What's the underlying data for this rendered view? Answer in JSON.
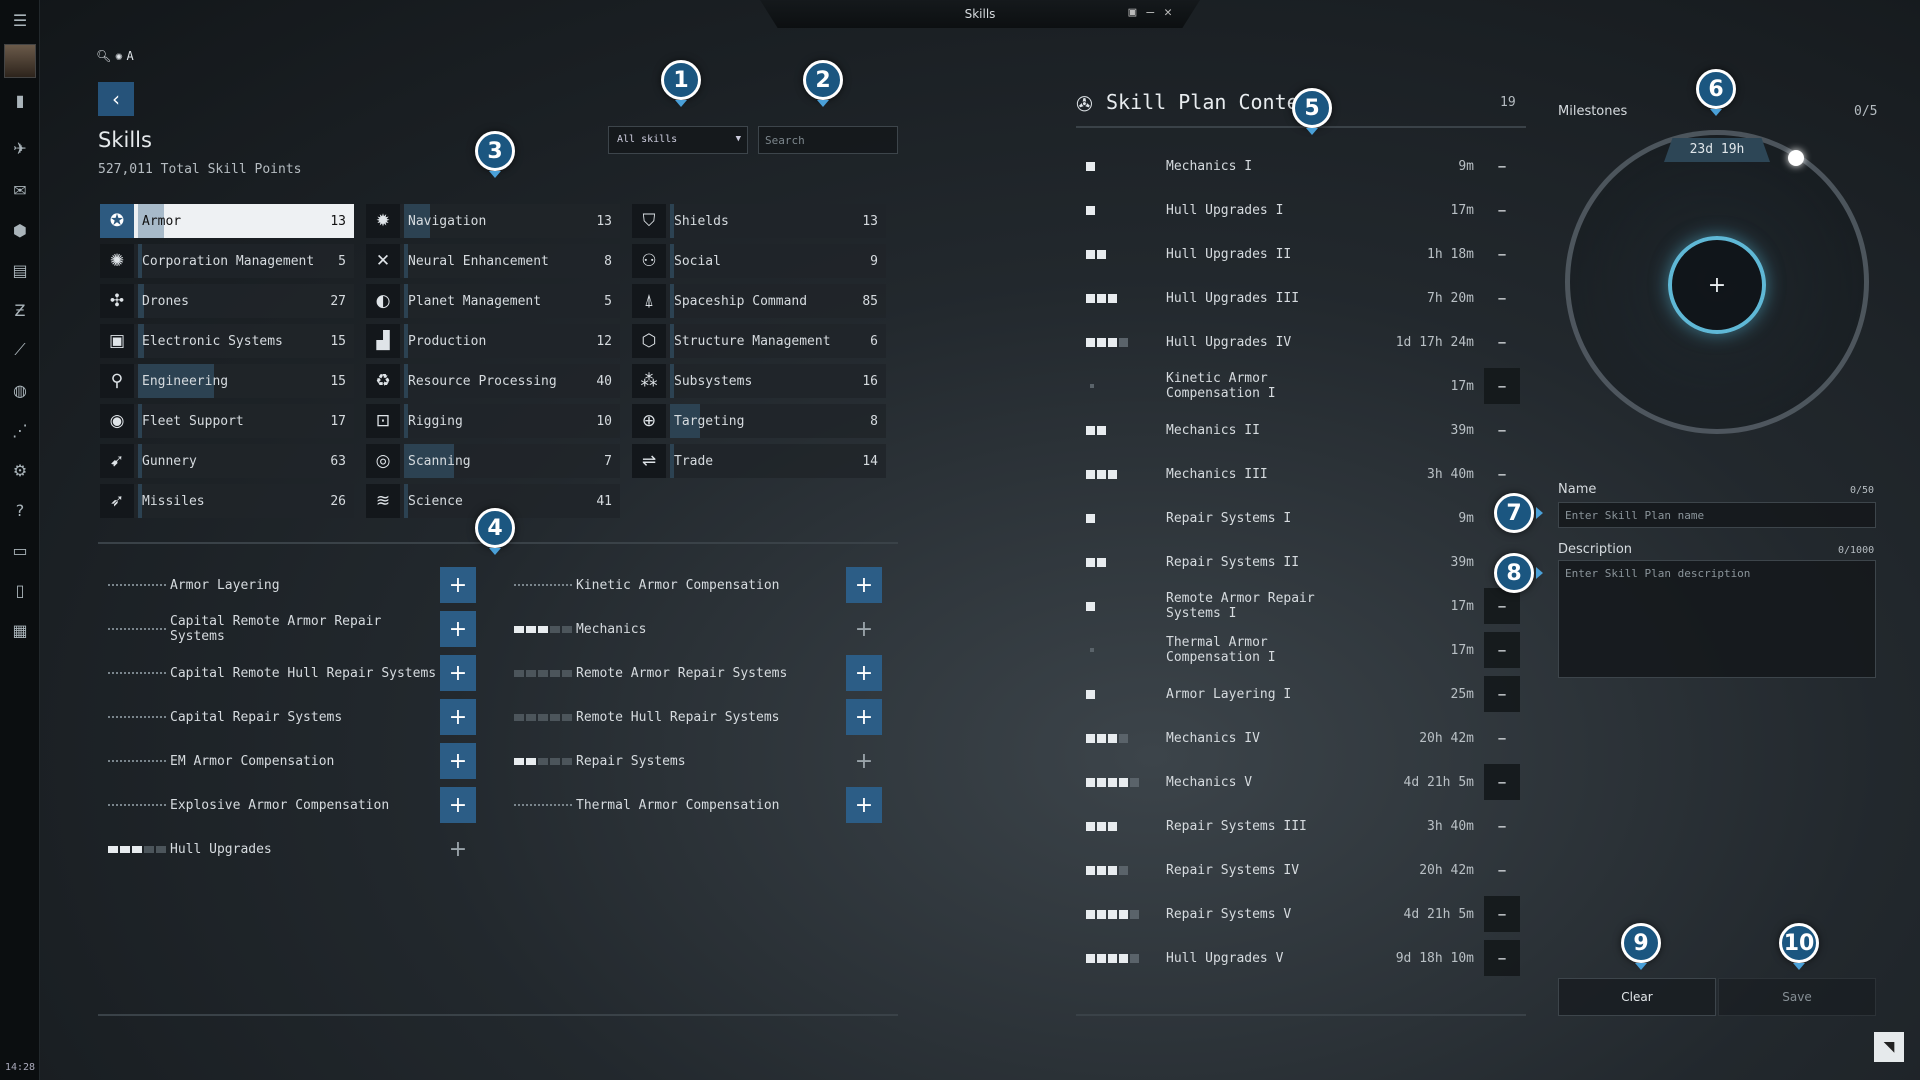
{
  "window": {
    "title": "Skills"
  },
  "sidebar": {
    "time": "14:28"
  },
  "header": {
    "title": "Skills",
    "total_sp": "527,011 Total Skill Points"
  },
  "filters": {
    "selected": "All skills",
    "search_placeholder": "Search"
  },
  "categories": [
    {
      "name": "Armor",
      "count": "13",
      "icon": "armor-icon",
      "glyph": "✪",
      "fill": 0.12,
      "selected": true
    },
    {
      "name": "Corporation Management",
      "count": "5",
      "icon": "corporation-icon",
      "glyph": "✺",
      "fill": 0.02
    },
    {
      "name": "Drones",
      "count": "27",
      "icon": "drone-icon",
      "glyph": "✣",
      "fill": 0.03
    },
    {
      "name": "Electronic Systems",
      "count": "15",
      "icon": "chip-icon",
      "glyph": "▣",
      "fill": 0.03
    },
    {
      "name": "Engineering",
      "count": "15",
      "icon": "engineering-icon",
      "glyph": "⚲",
      "fill": 0.35
    },
    {
      "name": "Fleet Support",
      "count": "17",
      "icon": "fleet-icon",
      "glyph": "◉",
      "fill": 0.02
    },
    {
      "name": "Gunnery",
      "count": "63",
      "icon": "gunnery-icon",
      "glyph": "➹",
      "fill": 0.02
    },
    {
      "name": "Missiles",
      "count": "26",
      "icon": "missile-icon",
      "glyph": "➶",
      "fill": 0.02
    },
    {
      "name": "Navigation",
      "count": "13",
      "icon": "navigation-icon",
      "glyph": "✹",
      "fill": 0.12
    },
    {
      "name": "Neural Enhancement",
      "count": "8",
      "icon": "neural-icon",
      "glyph": "✕",
      "fill": 0.02
    },
    {
      "name": "Planet Management",
      "count": "5",
      "icon": "planet-icon",
      "glyph": "◐",
      "fill": 0.02
    },
    {
      "name": "Production",
      "count": "12",
      "icon": "factory-icon",
      "glyph": "▟",
      "fill": 0.02
    },
    {
      "name": "Resource Processing",
      "count": "40",
      "icon": "recycle-icon",
      "glyph": "♻",
      "fill": 0.02
    },
    {
      "name": "Rigging",
      "count": "10",
      "icon": "rigging-icon",
      "glyph": "⊡",
      "fill": 0.02
    },
    {
      "name": "Scanning",
      "count": "7",
      "icon": "scanning-icon",
      "glyph": "◎",
      "fill": 0.23
    },
    {
      "name": "Science",
      "count": "41",
      "icon": "science-icon",
      "glyph": "≋",
      "fill": 0.02
    },
    {
      "name": "Shields",
      "count": "13",
      "icon": "shield-icon",
      "glyph": "⛉",
      "fill": 0.02
    },
    {
      "name": "Social",
      "count": "9",
      "icon": "social-icon",
      "glyph": "⚇",
      "fill": 0.02
    },
    {
      "name": "Spaceship Command",
      "count": "85",
      "icon": "ship-icon",
      "glyph": "⍋",
      "fill": 0.02
    },
    {
      "name": "Structure Management",
      "count": "6",
      "icon": "structure-icon",
      "glyph": "⬡",
      "fill": 0.02
    },
    {
      "name": "Subsystems",
      "count": "16",
      "icon": "subsystems-icon",
      "glyph": "⁂",
      "fill": 0.02
    },
    {
      "name": "Targeting",
      "count": "8",
      "icon": "target-icon",
      "glyph": "⊕",
      "fill": 0.14
    },
    {
      "name": "Trade",
      "count": "14",
      "icon": "trade-icon",
      "glyph": "⇌",
      "fill": 0.02
    }
  ],
  "skills": [
    {
      "name": "Armor Layering",
      "level": 0,
      "trained": false,
      "add_active": true
    },
    {
      "name": "Capital Remote Armor Repair Systems",
      "level": 0,
      "trained": false,
      "add_active": true
    },
    {
      "name": "Capital Remote Hull Repair Systems",
      "level": 0,
      "trained": false,
      "add_active": true
    },
    {
      "name": "Capital Repair Systems",
      "level": 0,
      "trained": false,
      "add_active": true
    },
    {
      "name": "EM Armor Compensation",
      "level": 0,
      "trained": false,
      "add_active": true
    },
    {
      "name": "Explosive Armor Compensation",
      "level": 0,
      "trained": false,
      "add_active": true
    },
    {
      "name": "Hull Upgrades",
      "level": 3,
      "trained": true,
      "add_active": false
    },
    {
      "name": "Kinetic Armor Compensation",
      "level": 0,
      "trained": false,
      "add_active": true
    },
    {
      "name": "Mechanics",
      "level": 3,
      "trained": true,
      "add_active": false
    },
    {
      "name": "Remote Armor Repair Systems",
      "level": 0,
      "trained": true,
      "add_active": true
    },
    {
      "name": "Remote Hull Repair Systems",
      "level": 0,
      "trained": true,
      "add_active": true
    },
    {
      "name": "Repair Systems",
      "level": 2,
      "trained": true,
      "add_active": false
    },
    {
      "name": "Thermal Armor Compensation",
      "level": 0,
      "trained": false,
      "add_active": true
    }
  ],
  "plan": {
    "title": "Skill Plan Content",
    "count": "19",
    "items": [
      {
        "name": "Mechanics I",
        "time": "9m",
        "level": 1
      },
      {
        "name": "Hull Upgrades I",
        "time": "17m",
        "level": 1
      },
      {
        "name": "Hull Upgrades II",
        "time": "1h 18m",
        "level": 2
      },
      {
        "name": "Hull Upgrades III",
        "time": "7h 20m",
        "level": 3
      },
      {
        "name": "Hull Upgrades IV",
        "time": "1d 17h 24m",
        "level": 4
      },
      {
        "name": "Kinetic Armor Compensation I",
        "time": "17m",
        "level": 0
      },
      {
        "name": "Mechanics II",
        "time": "39m",
        "level": 2
      },
      {
        "name": "Mechanics III",
        "time": "3h 40m",
        "level": 3
      },
      {
        "name": "Repair Systems I",
        "time": "9m",
        "level": 1
      },
      {
        "name": "Repair Systems II",
        "time": "39m",
        "level": 2
      },
      {
        "name": "Remote Armor Repair Systems I",
        "time": "17m",
        "level": 1
      },
      {
        "name": "Thermal Armor Compensation I",
        "time": "17m",
        "level": 0
      },
      {
        "name": "Armor Layering I",
        "time": "25m",
        "level": 1
      },
      {
        "name": "Mechanics IV",
        "time": "20h 42m",
        "level": 4
      },
      {
        "name": "Mechanics V",
        "time": "4d 21h 5m",
        "level": 5
      },
      {
        "name": "Repair Systems III",
        "time": "3h 40m",
        "level": 3
      },
      {
        "name": "Repair Systems IV",
        "time": "20h 42m",
        "level": 4
      },
      {
        "name": "Repair Systems V",
        "time": "4d 21h 5m",
        "level": 5
      },
      {
        "name": "Hull Upgrades V",
        "time": "9d 18h 10m",
        "level": 5
      }
    ]
  },
  "milestones": {
    "label": "Milestones",
    "count": "0/5",
    "total_time": "23d 19h"
  },
  "form": {
    "name_label": "Name",
    "name_count": "0/50",
    "name_placeholder": "Enter Skill Plan name",
    "desc_label": "Description",
    "desc_count": "0/1000",
    "desc_placeholder": "Enter Skill Plan description",
    "clear": "Clear",
    "save": "Save"
  },
  "callouts": [
    "1",
    "2",
    "3",
    "4",
    "5",
    "6",
    "7",
    "8",
    "9",
    "10"
  ],
  "colors": {
    "accent": "#2c5d86",
    "callout": "#1b5680",
    "ring_glow": "#5fb8d6"
  }
}
